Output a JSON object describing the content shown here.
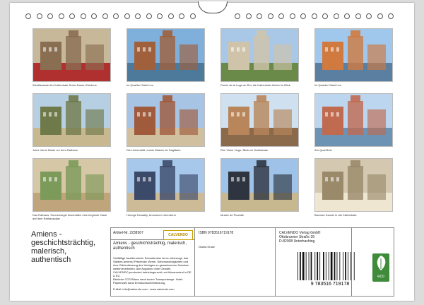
{
  "calendar": {
    "title_lines": [
      "Amiens -",
      "geschichtsträchtig,",
      "malerisch,",
      "authentisch"
    ]
  },
  "photos": [
    {
      "caption": "Westfassade der Kathedrale Notre-Dame d'Amiens",
      "icon": "cathedral-portal",
      "colors": [
        "#c8b89a",
        "#8a6e52",
        "#b03030"
      ]
    },
    {
      "caption": "Im Quartier Saint Leu",
      "icon": "canal-houses",
      "colors": [
        "#7fb0dc",
        "#a0603c",
        "#4d7a9a"
      ]
    },
    {
      "caption": "Parvis de la Loge du Roi, die Kathedrale Amien im Blick",
      "icon": "square-cathedral",
      "colors": [
        "#a9c7e6",
        "#cfc4aa",
        "#6a8a4a"
      ]
    },
    {
      "caption": "Im Quartier Saint Leu",
      "icon": "colorful-houses",
      "colors": [
        "#9fc8ec",
        "#d07a40",
        "#5a7fa0"
      ]
    },
    {
      "caption": "Jules Verne Büste vor dem Rathaus",
      "icon": "bust-statue",
      "colors": [
        "#b7cfe3",
        "#6f7a4a",
        "#c8b890"
      ]
    },
    {
      "caption": "Die Universität, vorhin Maison du Sagittaire",
      "icon": "brick-building",
      "colors": [
        "#a7c4e4",
        "#a05a3c",
        "#d0c0a0"
      ]
    },
    {
      "caption": "Rue Victor Hugo, Blick zur Kathedrale",
      "icon": "street-cathedral",
      "colors": [
        "#cfe0f0",
        "#b8865a",
        "#8a6a4a"
      ]
    },
    {
      "caption": "Am Quai Belu",
      "icon": "quay-reflection",
      "colors": [
        "#bcd6f0",
        "#c06a50",
        "#6c92b4"
      ]
    },
    {
      "caption": "Das Rathaus, Sonnensegel beschatten eine beginnte Oasé auf dem Rathausplatz",
      "icon": "sun-sails",
      "colors": [
        "#d6c7a6",
        "#7c9a5a",
        "#bfa47c"
      ]
    },
    {
      "caption": "Horloge Dewailly, bronzener Uhrenturm",
      "icon": "clock-tower",
      "colors": [
        "#a7c8ea",
        "#3c4a6a",
        "#cdbb98"
      ]
    },
    {
      "caption": "Musée de Picardie",
      "icon": "gate-museum",
      "colors": [
        "#9fc2e8",
        "#2e3540",
        "#c8b890"
      ]
    },
    {
      "caption": "Barocke Kanzel in der Kathedrale",
      "icon": "cathedral-interior",
      "colors": [
        "#d4c8b0",
        "#9a8a6a",
        "#efe6d2"
      ]
    }
  ],
  "card": {
    "artikel": "Artikel-Nr. 2238367",
    "logo": "CALVENDO",
    "title": "Amiens - geschichtsträchtig, malerisch, authentisch",
    "description": "Vielfältige facettenreiche Schaufenster ist es unbesorgt, das Städtes Amiens! Pittoreske Viertel, Sehenswürdigkeiten und eine Gärtenfassung des Verlages zu gewachsenen Zwecken weiterverarbeiten. Alle Angaben ohne Gewähr.",
    "publisher_line1": "CALVENDO produziert betriebsgerecht und klimaneutral in DE & EU.",
    "publisher_line2": "Bäuliche CO2-Bilanz dank kurzer Transportwege. Hotel-Papierwahl dank Emissionsunterstützung.",
    "email": "E-Mail: info@calvendo.com - www.calvendo.com",
    "isbn": "ISBN 9783516719178",
    "author": "Gisela Kruse",
    "verlag": [
      "CALVENDO Verlag GmbH",
      "Ottobrunner Straße 39",
      "D-82008 Unterhaching"
    ],
    "barcode_number": "9 783516 719178",
    "eco_label": "eco"
  }
}
